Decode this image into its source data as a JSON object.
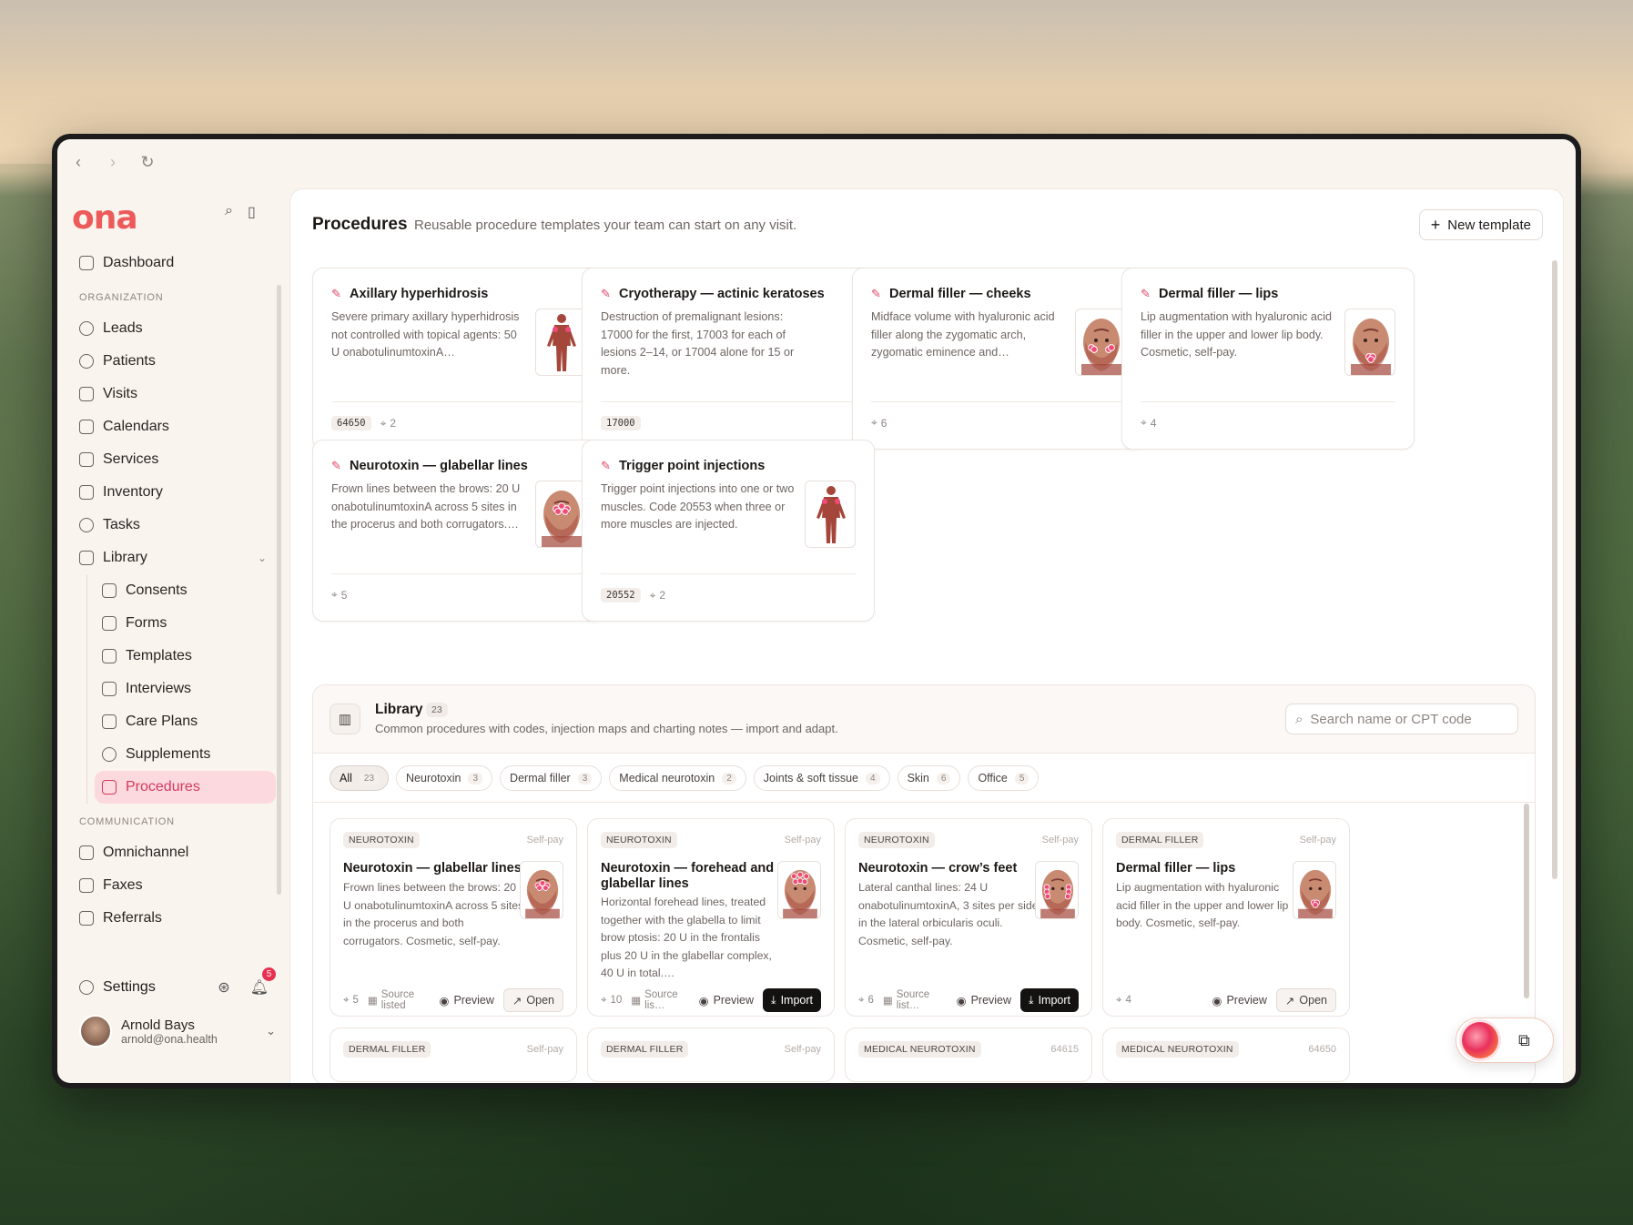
{
  "browser": {
    "back_icon": "‹",
    "forward_icon": "›",
    "reload_icon": "↻"
  },
  "brand": {
    "logo": "ona",
    "accent": "#ec5a5a"
  },
  "sidebar": {
    "top": [
      {
        "label": "Dashboard",
        "icon": "grid-icon"
      }
    ],
    "org_heading": "ORGANIZATION",
    "org_items": [
      {
        "label": "Leads",
        "icon": "target-icon"
      },
      {
        "label": "Patients",
        "icon": "users-icon"
      },
      {
        "label": "Visits",
        "icon": "calendar-check-icon"
      },
      {
        "label": "Calendars",
        "icon": "calendars-icon"
      },
      {
        "label": "Services",
        "icon": "tag-icon"
      },
      {
        "label": "Inventory",
        "icon": "box-icon"
      },
      {
        "label": "Tasks",
        "icon": "check-circle-icon"
      },
      {
        "label": "Library",
        "icon": "library-icon"
      }
    ],
    "library_items": [
      {
        "label": "Consents",
        "icon": "file-icon"
      },
      {
        "label": "Forms",
        "icon": "clipboard-icon"
      },
      {
        "label": "Templates",
        "icon": "file-icon"
      },
      {
        "label": "Interviews",
        "icon": "chat-bot-icon"
      },
      {
        "label": "Care Plans",
        "icon": "clipboard-list-icon"
      },
      {
        "label": "Supplements",
        "icon": "pill-icon"
      },
      {
        "label": "Procedures",
        "icon": "syringe-icon",
        "active": true
      }
    ],
    "comm_heading": "COMMUNICATION",
    "comm_items": [
      {
        "label": "Omnichannel",
        "icon": "messages-icon"
      },
      {
        "label": "Faxes",
        "icon": "printer-icon"
      },
      {
        "label": "Referrals",
        "icon": "document-icon"
      }
    ],
    "settings_label": "Settings",
    "notifications_count": "5",
    "user": {
      "name": "Arnold Bays",
      "email": "arnold@ona.health"
    }
  },
  "page": {
    "title": "Procedures",
    "subtitle": "Reusable procedure templates your team can start on any visit.",
    "new_button": "New template"
  },
  "templates": [
    {
      "title": "Axillary hyperhidrosis",
      "desc": "Severe primary axillary hyperhidrosis not controlled with topical agents: 50 U onabotulinumtoxinA…",
      "code": "64650",
      "sites": "2",
      "thumb": "body"
    },
    {
      "title": "Cryotherapy — actinic keratoses",
      "desc": "Destruction of premalignant lesions: 17000 for the first, 17003 for each of lesions 2–14, or 17004 alone for 15 or more.",
      "code": "17000",
      "sites": "",
      "thumb": ""
    },
    {
      "title": "Dermal filler — cheeks",
      "desc": "Midface volume with hyaluronic acid filler along the zygomatic arch, zygomatic eminence and…",
      "code": "",
      "sites": "6",
      "thumb": "face-cheeks"
    },
    {
      "title": "Dermal filler — lips",
      "desc": "Lip augmentation with hyaluronic acid filler in the upper and lower lip body. Cosmetic, self-pay.",
      "code": "",
      "sites": "4",
      "thumb": "face-lips"
    },
    {
      "title": "Neurotoxin — glabellar lines",
      "desc": "Frown lines between the brows: 20 U onabotulinumtoxinA across 5 sites in the procerus and both corrugators.…",
      "code": "",
      "sites": "5",
      "thumb": "face-brow"
    },
    {
      "title": "Trigger point injections",
      "desc": "Trigger point injections into one or two muscles. Code 20553 when three or more muscles are injected.",
      "code": "20552",
      "sites": "2",
      "thumb": "body"
    }
  ],
  "library": {
    "title": "Library",
    "count": "23",
    "subtitle": "Common procedures with codes, injection maps and charting notes — import and adapt.",
    "search_placeholder": "Search name or CPT code",
    "filters": [
      {
        "label": "All",
        "count": "23",
        "active": true
      },
      {
        "label": "Neurotoxin",
        "count": "3"
      },
      {
        "label": "Dermal filler",
        "count": "3"
      },
      {
        "label": "Medical neurotoxin",
        "count": "2"
      },
      {
        "label": "Joints & soft tissue",
        "count": "4"
      },
      {
        "label": "Skin",
        "count": "6"
      },
      {
        "label": "Office",
        "count": "5"
      }
    ],
    "items": [
      {
        "category": "NEUROTOXIN",
        "pay": "Self-pay",
        "title": "Neurotoxin — glabellar lines",
        "desc": "Frown lines between the brows: 20 U onabotulinumtoxinA across 5 sites in the procerus and both corrugators. Cosmetic, self-pay.",
        "sites": "5",
        "source": "Source listed",
        "preview": "Preview",
        "action": "Open",
        "action_type": "open",
        "thumb": "face-brow"
      },
      {
        "category": "NEUROTOXIN",
        "pay": "Self-pay",
        "title": "Neurotoxin — forehead and glabellar lines",
        "desc": "Horizontal forehead lines, treated together with the glabella to limit brow ptosis: 20 U in the frontalis plus 20 U in the glabellar complex, 40 U in total.…",
        "sites": "10",
        "source": "Source lis…",
        "preview": "Preview",
        "action": "Import",
        "action_type": "import",
        "thumb": "face-forehead"
      },
      {
        "category": "NEUROTOXIN",
        "pay": "Self-pay",
        "title": "Neurotoxin — crow’s feet",
        "desc": "Lateral canthal lines: 24 U onabotulinumtoxinA, 3 sites per side in the lateral orbicularis oculi. Cosmetic, self-pay.",
        "sites": "6",
        "source": "Source list…",
        "preview": "Preview",
        "action": "Import",
        "action_type": "import",
        "thumb": "face-eyes"
      },
      {
        "category": "DERMAL FILLER",
        "pay": "Self-pay",
        "title": "Dermal filler — lips",
        "desc": "Lip augmentation with hyaluronic acid filler in the upper and lower lip body. Cosmetic, self-pay.",
        "sites": "4",
        "source": "",
        "preview": "Preview",
        "action": "Open",
        "action_type": "open",
        "thumb": "face-lips"
      }
    ],
    "next_row": [
      {
        "category": "DERMAL FILLER",
        "pay": "Self-pay"
      },
      {
        "category": "DERMAL FILLER",
        "pay": "Self-pay"
      },
      {
        "category": "MEDICAL NEUROTOXIN",
        "pay": "64615"
      },
      {
        "category": "MEDICAL NEUROTOXIN",
        "pay": "64650"
      }
    ]
  }
}
